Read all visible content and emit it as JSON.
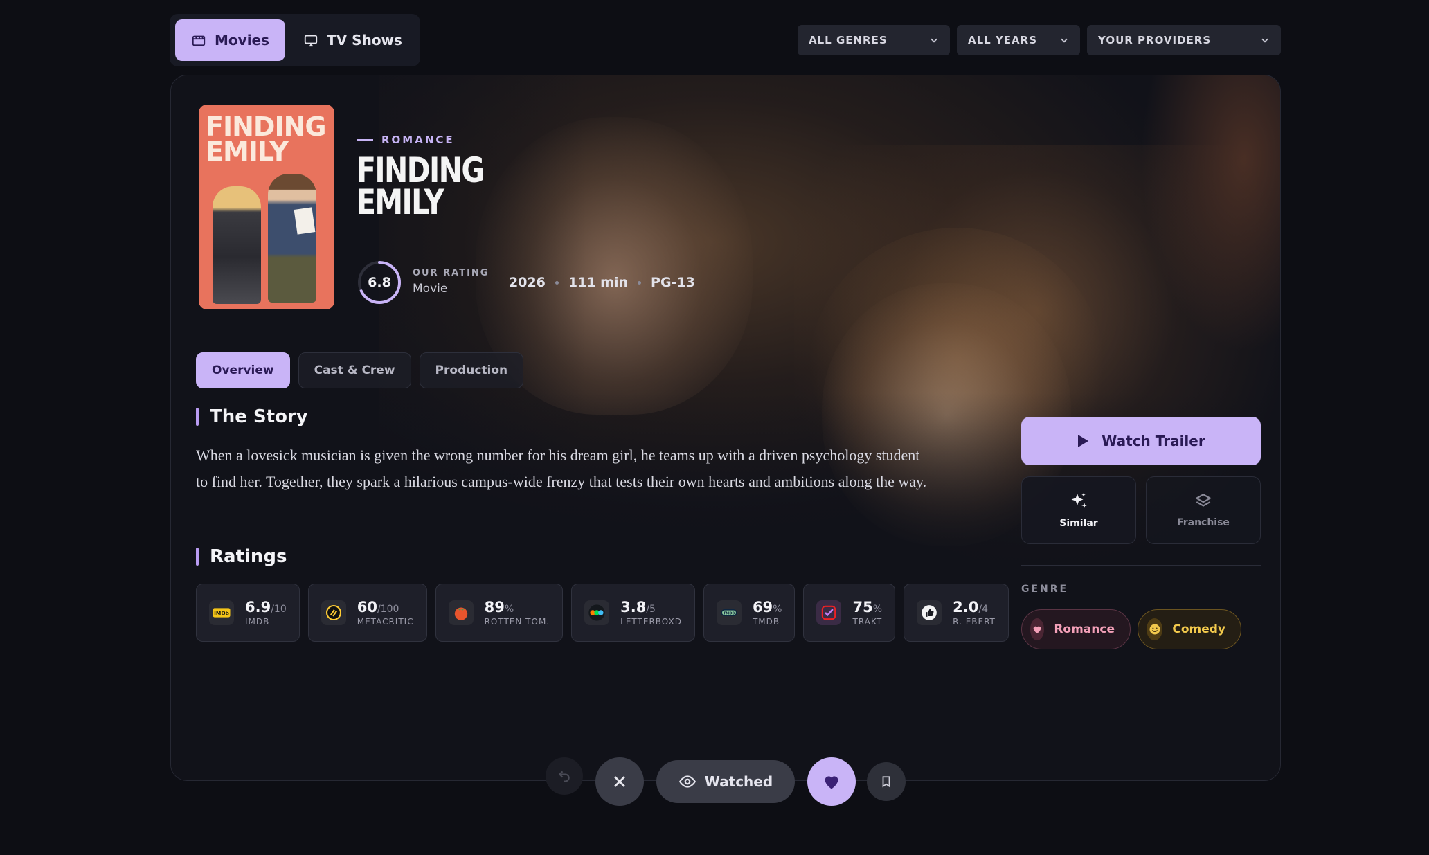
{
  "nav": {
    "movies_label": "Movies",
    "tv_label": "TV Shows"
  },
  "filters": {
    "genres": "ALL GENRES",
    "years": "ALL YEARS",
    "providers": "YOUR PROVIDERS"
  },
  "movie": {
    "genre_tag": "ROMANCE",
    "poster_title": "FINDING EMILY",
    "title_logo": "FINDING EMILY",
    "rating_label": "OUR RATING",
    "rating_value": "6.8",
    "rating_fraction": 0.68,
    "type": "Movie",
    "year": "2026",
    "runtime": "111 min",
    "certification": "PG-13"
  },
  "tabs": {
    "overview": "Overview",
    "cast": "Cast & Crew",
    "production": "Production"
  },
  "story": {
    "heading": "The Story",
    "text": "When a lovesick musician is given the wrong number for his dream girl, he teams up with a driven psychology student to find her. Together, they spark a hilarious campus-wide frenzy that tests their own hearts and ambitions along the way."
  },
  "ratings": {
    "heading": "Ratings",
    "items": [
      {
        "value": "6.9",
        "suffix": "/10",
        "label": "IMDB"
      },
      {
        "value": "60",
        "suffix": "/100",
        "label": "METACRITIC"
      },
      {
        "value": "89",
        "suffix": "%",
        "label": "ROTTEN TOM."
      },
      {
        "value": "3.8",
        "suffix": "/5",
        "label": "LETTERBOXD"
      },
      {
        "value": "69",
        "suffix": "%",
        "label": "TMDB"
      },
      {
        "value": "75",
        "suffix": "%",
        "label": "TRAKT"
      },
      {
        "value": "2.0",
        "suffix": "/4",
        "label": "R. EBERT"
      }
    ]
  },
  "side": {
    "trailer_label": "Watch Trailer",
    "similar_label": "Similar",
    "franchise_label": "Franchise",
    "genre_heading": "GENRE",
    "genres": [
      "Romance",
      "Comedy"
    ]
  },
  "actions": {
    "watched_label": "Watched"
  },
  "colors": {
    "accent": "#c9b4f7",
    "accent_dark": "#2a1a55",
    "background": "#0d0e14",
    "romance": "#f3a0b8",
    "comedy": "#f2c94c"
  }
}
